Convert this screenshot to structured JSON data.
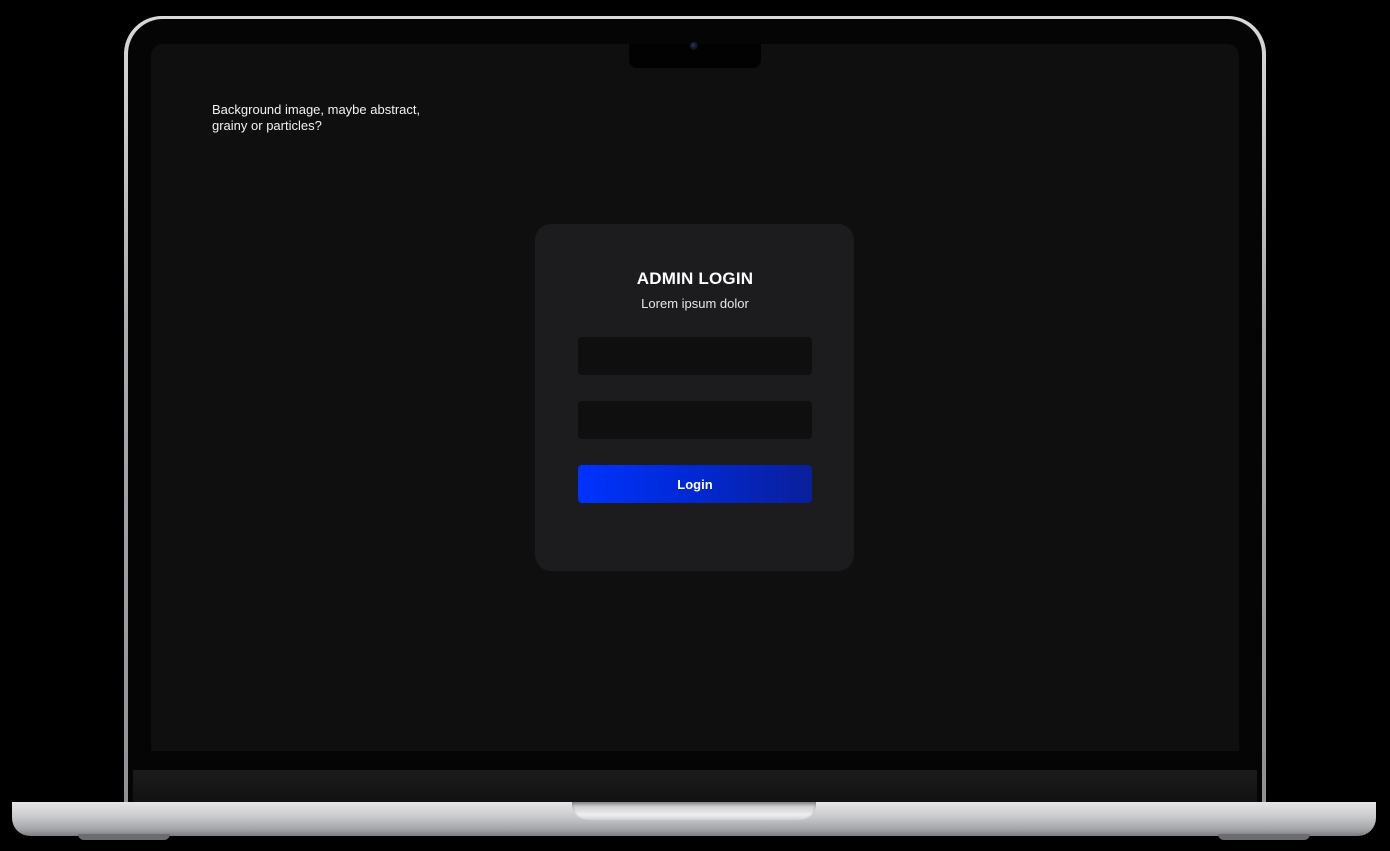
{
  "background_note": {
    "line1": "Background image, maybe abstract,",
    "line2": "grainy or particles?"
  },
  "login_card": {
    "title": "ADMIN LOGIN",
    "subtitle": "Lorem ipsum dolor",
    "username_field": {
      "value": "",
      "placeholder": ""
    },
    "password_field": {
      "value": "",
      "placeholder": ""
    },
    "login_label": "Login"
  },
  "colors": {
    "page_background": "#000000",
    "screen_background": "#0f0f10",
    "card_background": "#1c1c1f",
    "input_background": "#0f0f10",
    "button_gradient_start": "#0033ff",
    "button_gradient_end": "#0a1f9a"
  }
}
